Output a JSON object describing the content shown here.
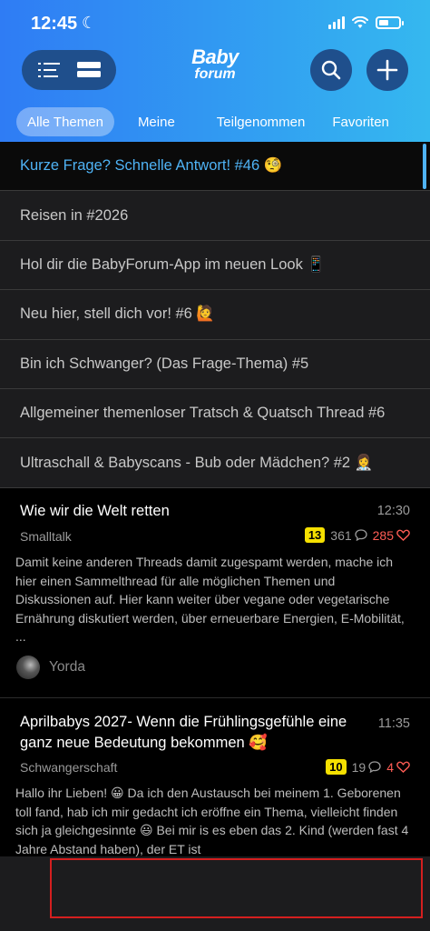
{
  "status": {
    "time": "12:45",
    "battery_level": 0.5
  },
  "header": {
    "logo_line1": "Baby",
    "logo_line2": "forum",
    "tabs": [
      {
        "label": "Alle Themen",
        "active": true
      },
      {
        "label": "Meine",
        "active": false
      },
      {
        "label": "Teilgenommen",
        "active": false
      },
      {
        "label": "Favoriten",
        "active": false
      }
    ]
  },
  "pinned": [
    "Kurze Frage? Schnelle Antwort! #46 🧐",
    "Reisen in #2026",
    "Hol dir die BabyForum-App im neuen Look 📱",
    "Neu hier, stell dich vor! #6 🙋",
    "Bin ich Schwanger? (Das Frage-Thema) #5",
    "Allgemeiner themenloser Tratsch & Quatsch Thread #6",
    "Ultraschall & Babyscans - Bub oder Mädchen? #2 👩‍⚕️"
  ],
  "threads": [
    {
      "title": "Wie wir die Welt retten",
      "time": "12:30",
      "category": "Smalltalk",
      "badge": "13",
      "comments": "361",
      "likes": "285",
      "body": "Damit keine anderen Threads damit zugespamt werden, mache ich hier einen Sammelthread für alle möglichen Themen und Diskussionen auf. Hier kann weiter über vegane oder vegetarische Ernährung diskutiert werden, über erneuerbare Energien, E-Mobilität, ...",
      "author": "Yorda"
    },
    {
      "title": "Aprilbabys 2027- Wenn die Frühlingsgefühle eine ganz neue Bedeutung bekommen 🥰",
      "time": "11:35",
      "category": "Schwangerschaft",
      "badge": "10",
      "comments": "19",
      "likes": "4",
      "body": "Hallo ihr Lieben! 😀 Da ich den Austausch bei meinem 1. Geborenen toll fand, hab ich mir gedacht ich eröffne ein Thema, vielleicht finden sich ja gleichgesinnte 😃 Bei mir is es eben das 2. Kind (werden fast 4 Jahre Abstand haben), der ET ist"
    }
  ],
  "colors": {
    "accent_blue": "#4fb3f5",
    "badge_yellow": "#f5e000",
    "like_red": "#ff5d55",
    "highlight_red": "#d41f1f"
  }
}
